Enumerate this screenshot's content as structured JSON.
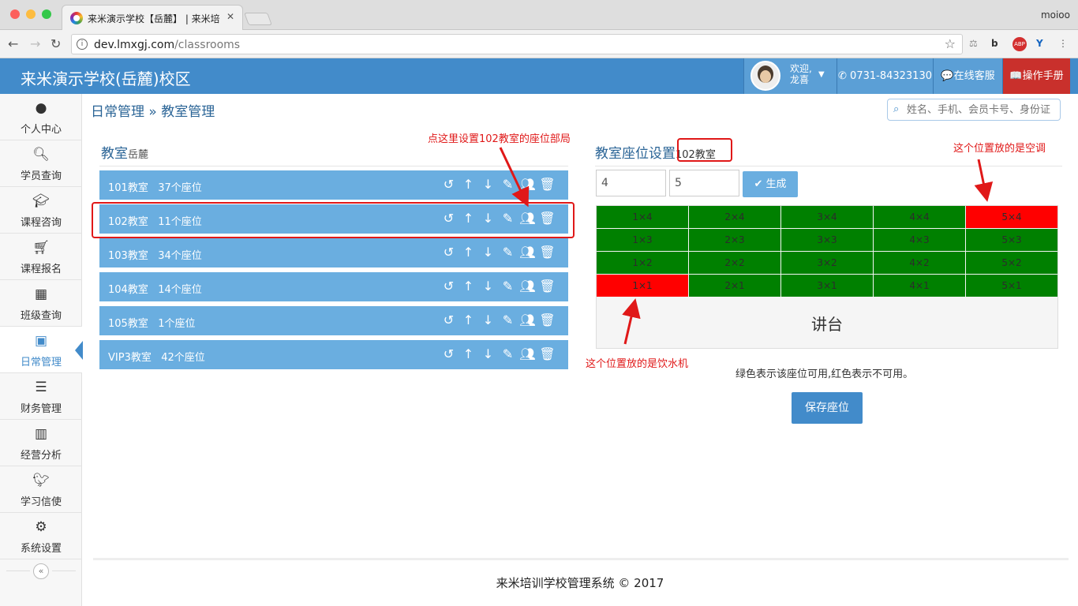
{
  "browser": {
    "tab_title": "来米演示学校【岳麓】 | 来米培",
    "profile": "moioo",
    "url_host": "dev.lmxgj.com",
    "url_path": "/classrooms"
  },
  "header": {
    "brand": "来米演示学校(岳麓)校区",
    "welcome": "欢迎,",
    "user": "龙喜",
    "phone": "0731-84323130",
    "service": "在线客服",
    "manual": "操作手册"
  },
  "sidebar": {
    "items": [
      {
        "label": "个人中心",
        "icon": "user-icon"
      },
      {
        "label": "学员查询",
        "icon": "search-icon"
      },
      {
        "label": "课程咨询",
        "icon": "graduation-cap-icon"
      },
      {
        "label": "课程报名",
        "icon": "cart-icon"
      },
      {
        "label": "班级查询",
        "icon": "cubes-icon"
      },
      {
        "label": "日常管理",
        "icon": "daily-icon"
      },
      {
        "label": "财务管理",
        "icon": "list-icon"
      },
      {
        "label": "经营分析",
        "icon": "bar-chart-icon"
      },
      {
        "label": "学习信使",
        "icon": "twitter-icon"
      },
      {
        "label": "系统设置",
        "icon": "cogs-icon"
      }
    ],
    "active_index": 5,
    "collapse": "«"
  },
  "breadcrumb": "日常管理 » 教室管理",
  "search": {
    "placeholder": "姓名、手机、会员卡号、身份证"
  },
  "classrooms": {
    "title": "教室",
    "campus": "岳麓",
    "rooms": [
      {
        "name": "101教室",
        "seats": "37个座位"
      },
      {
        "name": "102教室",
        "seats": "11个座位"
      },
      {
        "name": "103教室",
        "seats": "34个座位"
      },
      {
        "name": "104教室",
        "seats": "14个座位"
      },
      {
        "name": "105教室",
        "seats": "1个座位"
      },
      {
        "name": "VIP3教室",
        "seats": "42个座位"
      }
    ]
  },
  "seating": {
    "title": "教室座位设置",
    "room": "102教室",
    "cols_value": "4",
    "rows_value": "5",
    "generate_label": "✔ 生成",
    "rows": [
      [
        {
          "label": "1×4",
          "available": true
        },
        {
          "label": "2×4",
          "available": true
        },
        {
          "label": "3×4",
          "available": true
        },
        {
          "label": "4×4",
          "available": true
        },
        {
          "label": "5×4",
          "available": false
        }
      ],
      [
        {
          "label": "1×3",
          "available": true
        },
        {
          "label": "2×3",
          "available": true
        },
        {
          "label": "3×3",
          "available": true
        },
        {
          "label": "4×3",
          "available": true
        },
        {
          "label": "5×3",
          "available": true
        }
      ],
      [
        {
          "label": "1×2",
          "available": true
        },
        {
          "label": "2×2",
          "available": true
        },
        {
          "label": "3×2",
          "available": true
        },
        {
          "label": "4×2",
          "available": true
        },
        {
          "label": "5×2",
          "available": true
        }
      ],
      [
        {
          "label": "1×1",
          "available": false
        },
        {
          "label": "2×1",
          "available": true
        },
        {
          "label": "3×1",
          "available": true
        },
        {
          "label": "4×1",
          "available": true
        },
        {
          "label": "5×1",
          "available": true
        }
      ]
    ],
    "podium": "讲台",
    "legend": "绿色表示该座位可用,红色表示不可用。",
    "save_label": "保存座位",
    "colors": {
      "available": "#008000",
      "unavailable": "#ff0000"
    }
  },
  "annotations": {
    "click_here": "点这里设置102教室的座位部局",
    "air_conditioner": "这个位置放的是空调",
    "water_dispenser": "这个位置放的是饮水机"
  },
  "footer": "来米培训学校管理系统 © 2017"
}
